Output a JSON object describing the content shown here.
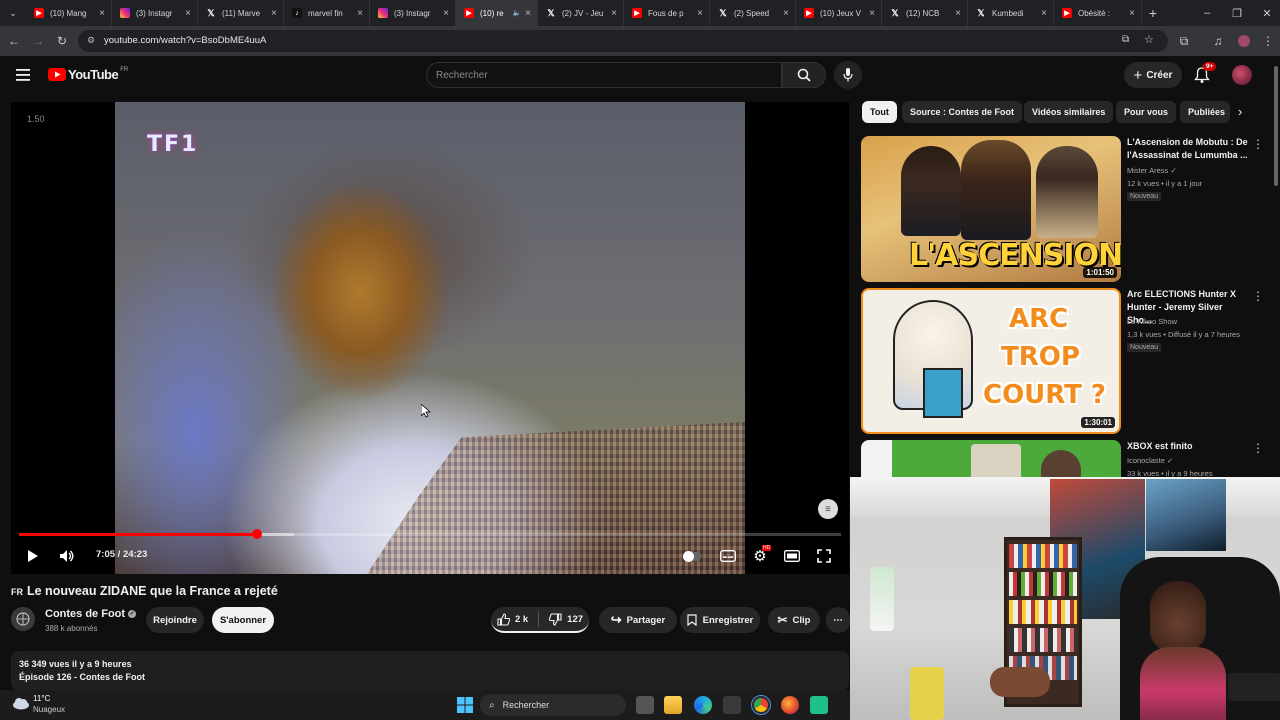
{
  "browser": {
    "tabs": [
      {
        "label": "(10) Mang",
        "favicon": "youtube-icon"
      },
      {
        "label": "(3) Instagr",
        "favicon": "instagram-icon"
      },
      {
        "label": "(11) Marve",
        "favicon": "x-icon"
      },
      {
        "label": "marvel fin",
        "favicon": "tiktok-icon"
      },
      {
        "label": "(3) Instagr",
        "favicon": "instagram-icon"
      },
      {
        "label": "(10) re",
        "favicon": "youtube-icon",
        "active": true
      },
      {
        "label": "(2) JV - Jeu",
        "favicon": "x-icon"
      },
      {
        "label": "Fous de p",
        "favicon": "youtube-icon"
      },
      {
        "label": "(2) Speed",
        "favicon": "x-icon"
      },
      {
        "label": "(10) Jeux V",
        "favicon": "youtube-icon"
      },
      {
        "label": "(12) NCB",
        "favicon": "x-icon"
      },
      {
        "label": "Kumbedi",
        "favicon": "x-icon"
      },
      {
        "label": "Obésité :",
        "favicon": "youtube-icon"
      }
    ],
    "url": "youtube.com/watch?v=BsoDbME4uuA"
  },
  "youtube": {
    "logo_text": "YouTube",
    "logo_country": "FR",
    "search_placeholder": "Rechercher",
    "create_label": "Créer",
    "notif_count": "9+"
  },
  "player": {
    "speed_label": "1.50",
    "watermark": "TF1",
    "time_current": "7:05",
    "time_total": "24:23",
    "progress": 0.29,
    "buffered": 0.335
  },
  "video": {
    "lang_prefix": "FR",
    "title": "Le nouveau ZIDANE que la France a rejeté",
    "channel": "Contes de Foot",
    "subscribers": "388 k abonnés",
    "join_label": "Rejoindre",
    "subscribe_label": "S'abonner",
    "likes": "2 k",
    "dislikes": "127",
    "share_label": "Partager",
    "save_label": "Enregistrer",
    "clip_label": "Clip",
    "views_line": "36 349 vues  il y a 9 heures",
    "episode_line": "Épisode 126 - Contes de Foot"
  },
  "sidebar": {
    "chips": [
      "Tout",
      "Source : Contes de Foot",
      "Vidéos similaires",
      "Pour vous",
      "Publiées"
    ],
    "videos": [
      {
        "title": "L'Ascension de Mobutu : De l'Assassinat de Lumumba ...",
        "channel": "Mister Aress",
        "meta": "12 k vues • il y a 1 jour",
        "badge": "Nouveau",
        "duration": "1:01:50",
        "thumb_text": "L'ASCENSION"
      },
      {
        "title": "Arc ELECTIONS Hunter X Hunter - Jeremy Silver Sho...",
        "channel": "Le Kikoo Show",
        "meta": "1,3 k vues • Diffusé il y a 7 heures",
        "badge": "Nouveau",
        "duration": "1:30:01",
        "thumb_lines": [
          "ARC",
          "TROP",
          "COURT ?"
        ]
      },
      {
        "title": "XBOX est finito",
        "channel": "Iconoclaste",
        "meta": "33 k vues • il y a 9 heures"
      }
    ]
  },
  "taskbar": {
    "temperature": "11°C",
    "weather": "Nuageux",
    "search_label": "Rechercher"
  }
}
